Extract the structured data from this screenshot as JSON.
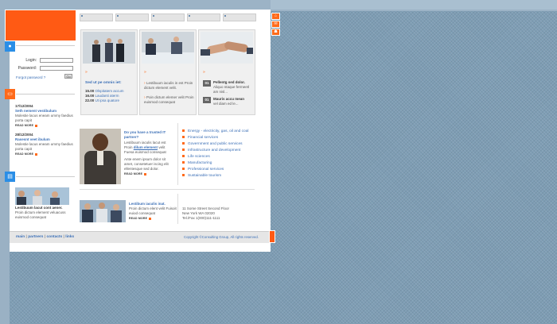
{
  "colors": {
    "accent": "#ff5a14",
    "link": "#3b6fb6",
    "background": "#7e9db4"
  },
  "icons": {
    "user": "user-icon",
    "chat": "chat-icon",
    "pages": "pages-icon",
    "home": "home-icon",
    "mail": "mail-icon",
    "sitemap": "sitemap-icon"
  },
  "login": {
    "login_label": "Login:",
    "password_label": "Password:",
    "forgot_link": "Forgot password ?",
    "go_button": "Go"
  },
  "news": [
    {
      "date": "17/12/2004",
      "title": "Seth nement vestibulum",
      "text": "Molestie lacus eneam ummy faedius porta capit",
      "more": "READ MORE"
    },
    {
      "date": "28/12/2004",
      "title": "Rasesnt veet ibulum",
      "text": "Molestie lacus eneam ummy faedius porta capit",
      "more": "READ MORE"
    }
  ],
  "sidebar_feature": {
    "title": "Lestibuum lacut cont aener.",
    "text": "Proin dictum element veluacuss euismod consequat"
  },
  "box1": {
    "title": "Sed ut pe omnis iet:",
    "rows": [
      {
        "time": "15.00",
        "text": "Olspitatem accum"
      },
      {
        "time": "16.00",
        "text": "Laudanti aterm"
      },
      {
        "time": "22.00",
        "text": "Ut ipsa quatore"
      }
    ]
  },
  "box2": {
    "items": [
      "Lestibuum iaculis in est Proin dictum element velit.",
      "Poin dictum elemer velit Proin euismod consequat"
    ]
  },
  "box3": {
    "items": [
      {
        "num": "01",
        "title": "Pellentg sed dolor.",
        "text": "Aliquo ntaque fermeetl am nisl..."
      },
      {
        "num": "01",
        "title": "Mauris accu mean",
        "text": "vel diam ed le..."
      }
    ]
  },
  "partner": {
    "title": "Do you have a trusted IT partner?",
    "text1_a": "Lestibuum iaculis lacut est Proin",
    "text1_link": "dilum element",
    "text1_b": "velit Fuesa euismod consequat",
    "text2": "Ante enem ipsum dolor sit amet, consetetuer iscing elit ellentesque sed dolor.",
    "more": "READ MORE"
  },
  "categories": [
    "Energy - electricity, gas, oil and coal",
    "Financial services",
    "Government and public services",
    "Infrastructure and development",
    "Life sciences",
    "Manufacturing",
    "Professional services",
    "Sustainable tourism"
  ],
  "lower_feature": {
    "title": "Lestibum iaculis inat.",
    "text": "Proin dictum elent velit Fuisoit euiod consequat",
    "more": "READ MORE"
  },
  "address": {
    "line1": "11 Some Street Second Floor",
    "line2": "New York WA 02020",
    "line3": "Tel./Fax 1(000)111-1111"
  },
  "footer": {
    "links": [
      "main",
      "partners",
      "contacts",
      "links"
    ],
    "copyright": "Copyright ©Consulting Group, All rights reserved."
  }
}
